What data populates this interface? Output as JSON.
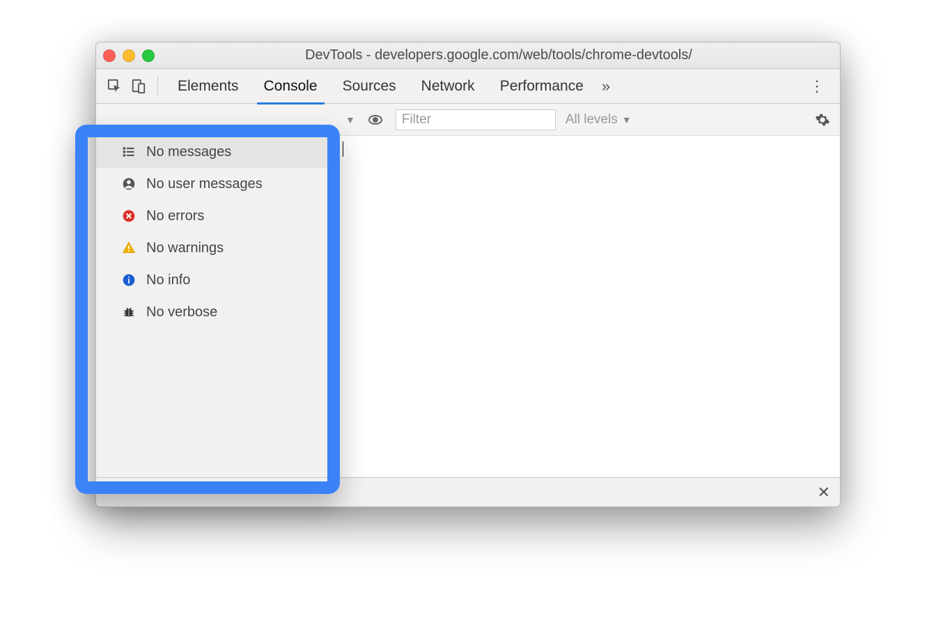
{
  "window": {
    "title": "DevTools - developers.google.com/web/tools/chrome-devtools/"
  },
  "tabs": {
    "items": [
      "Elements",
      "Console",
      "Sources",
      "Network",
      "Performance"
    ],
    "active_index": 1,
    "more_glyph": "»",
    "kebab_glyph": "⋮"
  },
  "filterbar": {
    "context_dropdown_glyph": "▼",
    "eye_icon": "eye",
    "filter_placeholder": "Filter",
    "levels_label": "All levels",
    "levels_glyph": "▼"
  },
  "sidebar": {
    "items": [
      {
        "icon": "list",
        "label": "No messages",
        "selected": true
      },
      {
        "icon": "user",
        "label": "No user messages",
        "selected": false
      },
      {
        "icon": "error",
        "label": "No errors",
        "selected": false
      },
      {
        "icon": "warning",
        "label": "No warnings",
        "selected": false
      },
      {
        "icon": "info",
        "label": "No info",
        "selected": false
      },
      {
        "icon": "verbose",
        "label": "No verbose",
        "selected": false
      }
    ]
  },
  "drawer": {
    "close_glyph": "✕"
  }
}
